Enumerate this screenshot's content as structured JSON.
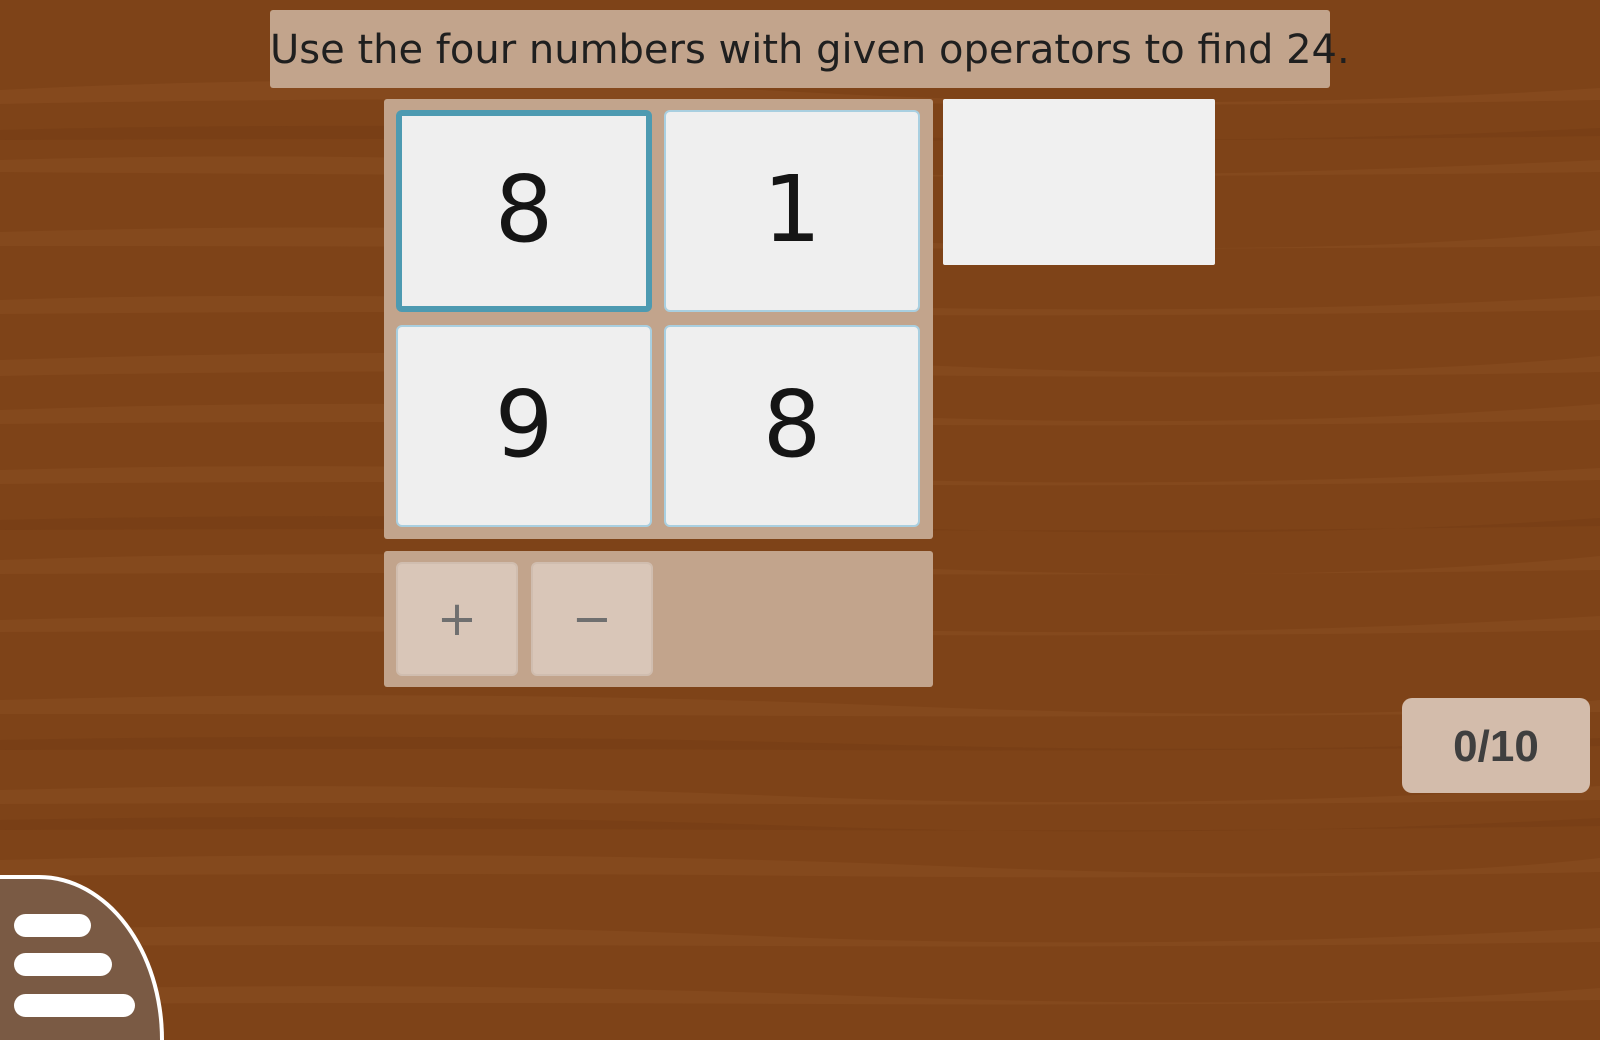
{
  "instruction": "Use the four numbers with given operators to find 24.",
  "numbers": [
    "8",
    "1",
    "9",
    "8"
  ],
  "selected_card_index": 0,
  "result_value": "",
  "operators": [
    "+",
    "−"
  ],
  "score": "0/10",
  "icons": {
    "menu": "hamburger-menu-icon"
  },
  "colors": {
    "background": "#7e4318",
    "panel": "#c2a48c",
    "card": "#efefef",
    "selected_border": "#4d9ab1",
    "card_border": "#a9cfe0",
    "operator_button": "#d9c6b8",
    "score_box": "#d3bcab",
    "menu_button": "#7a5a44"
  }
}
